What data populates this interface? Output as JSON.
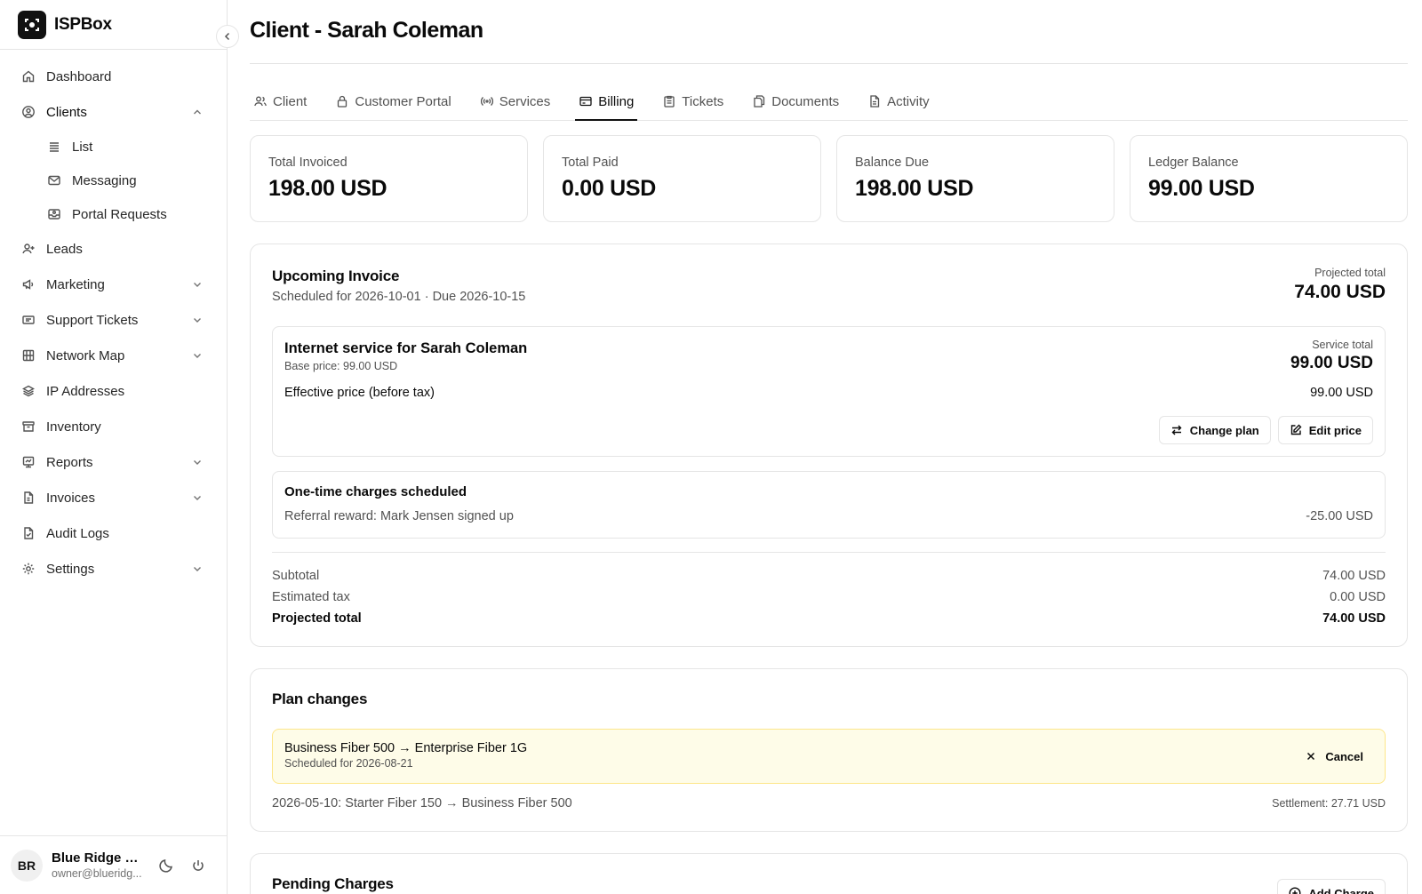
{
  "app": {
    "name": "ISPBox"
  },
  "sidebar": {
    "items": [
      {
        "label": "Dashboard",
        "icon": "home-icon"
      },
      {
        "label": "Clients",
        "icon": "user-circle-icon",
        "expanded": true,
        "children": [
          {
            "label": "List",
            "icon": "list-icon"
          },
          {
            "label": "Messaging",
            "icon": "mail-icon"
          },
          {
            "label": "Portal Requests",
            "icon": "inbox-icon"
          }
        ]
      },
      {
        "label": "Leads",
        "icon": "user-plus-icon"
      },
      {
        "label": "Marketing",
        "icon": "megaphone-icon"
      },
      {
        "label": "Support Tickets",
        "icon": "ticket-icon"
      },
      {
        "label": "Network Map",
        "icon": "map-icon"
      },
      {
        "label": "IP Addresses",
        "icon": "layers-icon"
      },
      {
        "label": "Inventory",
        "icon": "archive-icon"
      },
      {
        "label": "Reports",
        "icon": "chart-icon"
      },
      {
        "label": "Invoices",
        "icon": "file-dollar-icon"
      },
      {
        "label": "Audit Logs",
        "icon": "file-check-icon"
      },
      {
        "label": "Settings",
        "icon": "gear-icon"
      }
    ]
  },
  "user": {
    "initials": "BR",
    "name": "Blue Ridge O...",
    "email": "owner@blueridg..."
  },
  "page": {
    "title": "Client - Sarah Coleman"
  },
  "tabs": [
    {
      "label": "Client"
    },
    {
      "label": "Customer Portal"
    },
    {
      "label": "Services"
    },
    {
      "label": "Billing",
      "active": true
    },
    {
      "label": "Tickets"
    },
    {
      "label": "Documents"
    },
    {
      "label": "Activity"
    }
  ],
  "stats": [
    {
      "label": "Total Invoiced",
      "value": "198.00 USD"
    },
    {
      "label": "Total Paid",
      "value": "0.00 USD"
    },
    {
      "label": "Balance Due",
      "value": "198.00 USD"
    },
    {
      "label": "Ledger Balance",
      "value": "99.00 USD"
    }
  ],
  "upcoming": {
    "title": "Upcoming Invoice",
    "subtitle": "Scheduled for 2026-10-01 · Due 2026-10-15",
    "projected_label": "Projected total",
    "projected_value": "74.00 USD",
    "service": {
      "title": "Internet service for Sarah Coleman",
      "base": "Base price: 99.00 USD",
      "total_label": "Service total",
      "total_value": "99.00 USD",
      "effective_label": "Effective price (before tax)",
      "effective_value": "99.00 USD",
      "change_plan": "Change plan",
      "edit_price": "Edit price"
    },
    "one_time": {
      "title": "One-time charges scheduled",
      "items": [
        {
          "label": "Referral reward: Mark Jensen signed up",
          "amount": "-25.00 USD"
        }
      ]
    },
    "totals": {
      "subtotal_label": "Subtotal",
      "subtotal": "74.00 USD",
      "tax_label": "Estimated tax",
      "tax": "0.00 USD",
      "projected_label": "Projected total",
      "projected": "74.00 USD"
    }
  },
  "plan_changes": {
    "title": "Plan changes",
    "pending": {
      "title": "Business Fiber 500 → Enterprise Fiber 1G",
      "subtitle": "Scheduled for 2026-08-21",
      "cancel": "Cancel"
    },
    "history": [
      {
        "text": "2026-05-10: Starter Fiber 150 → Business Fiber 500",
        "settlement": "Settlement: 27.71 USD"
      }
    ]
  },
  "pending_charges": {
    "title": "Pending Charges",
    "add": "Add Charge"
  },
  "colors": {
    "accent": "#111111",
    "warning_bg": "#fefce8",
    "warning_border": "#fde68a"
  }
}
